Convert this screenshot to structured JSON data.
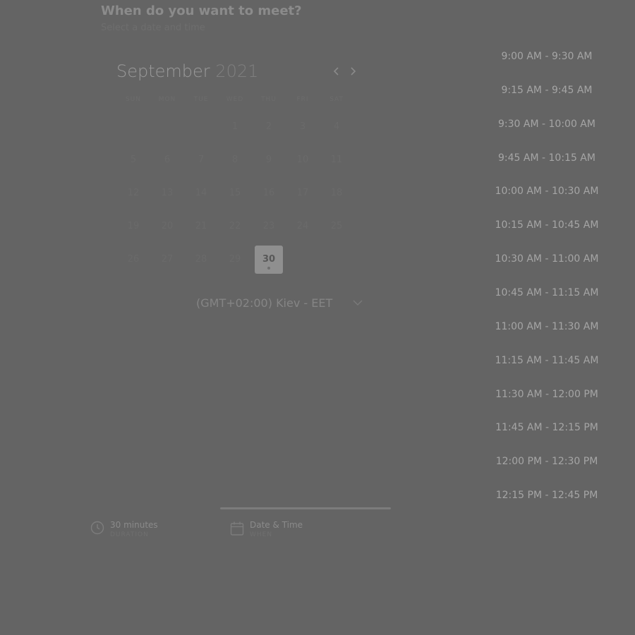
{
  "header": {
    "title": "When do you want to meet?",
    "subtitle": "Select a date and time"
  },
  "calendar": {
    "month": "September",
    "year": "2021",
    "weekdays": [
      "SUN",
      "MON",
      "TUE",
      "WED",
      "THU",
      "FRI",
      "SAT"
    ],
    "days": [
      "1",
      "2",
      "3",
      "4",
      "5",
      "6",
      "7",
      "8",
      "9",
      "10",
      "11",
      "12",
      "13",
      "14",
      "15",
      "16",
      "17",
      "18",
      "19",
      "20",
      "21",
      "22",
      "23",
      "24",
      "25",
      "26",
      "27",
      "28",
      "29",
      "30"
    ],
    "selected_day": "30"
  },
  "timezone": {
    "label": "(GMT+02:00) Kiev - EET"
  },
  "time_slots": [
    "9:00 AM - 9:30 AM",
    "9:15 AM - 9:45 AM",
    "9:30 AM - 10:00 AM",
    "9:45 AM - 10:15 AM",
    "10:00 AM - 10:30 AM",
    "10:15 AM - 10:45 AM",
    "10:30 AM - 11:00 AM",
    "10:45 AM - 11:15 AM",
    "11:00 AM - 11:30 AM",
    "11:15 AM - 11:45 AM",
    "11:30 AM - 12:00 PM",
    "11:45 AM - 12:15 PM",
    "12:00 PM - 12:30 PM",
    "12:15 PM - 12:45 PM"
  ],
  "steps": {
    "duration": {
      "title": "30 minutes",
      "subtitle": "DURATION"
    },
    "datetime": {
      "title": "Date & Time",
      "subtitle": "WHEN"
    }
  },
  "colors": {
    "overlay": "#646464",
    "selected_day_bg": "#8f8f8f",
    "slot_text": "#a5a5a5"
  },
  "icons": {
    "prev": "chevron-left-icon",
    "next": "chevron-right-icon",
    "timezone": "chevron-down-icon",
    "duration": "clock-icon",
    "datetime": "calendar-icon"
  }
}
